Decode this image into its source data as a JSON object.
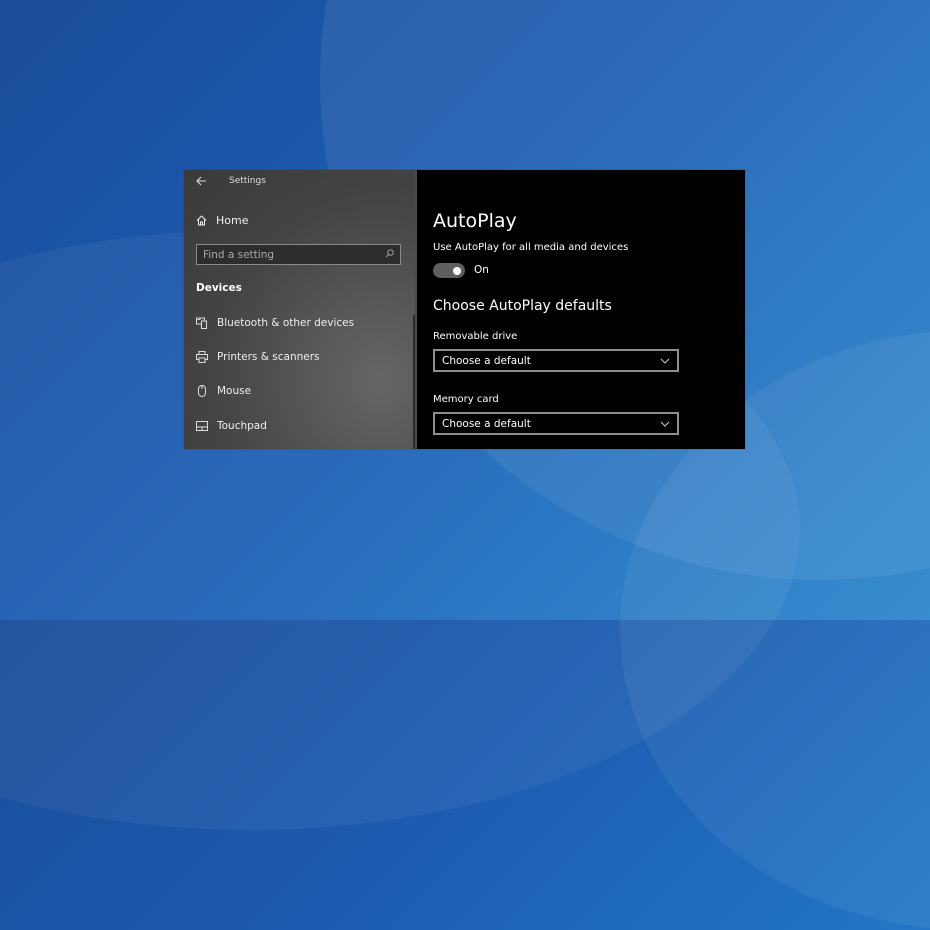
{
  "window": {
    "title": "Settings",
    "back_icon": "back-arrow-icon"
  },
  "sidebar": {
    "home_label": "Home",
    "search_placeholder": "Find a setting",
    "section": "Devices",
    "items": [
      {
        "label": "Bluetooth & other devices",
        "icon": "bluetooth-devices-icon"
      },
      {
        "label": "Printers & scanners",
        "icon": "printer-icon"
      },
      {
        "label": "Mouse",
        "icon": "mouse-icon"
      },
      {
        "label": "Touchpad",
        "icon": "touchpad-icon"
      }
    ]
  },
  "main": {
    "title": "AutoPlay",
    "toggle_label": "Use AutoPlay for all media and devices",
    "toggle_state": "On",
    "toggle_on": true,
    "defaults_heading": "Choose AutoPlay defaults",
    "fields": [
      {
        "label": "Removable drive",
        "value": "Choose a default"
      },
      {
        "label": "Memory card",
        "value": "Choose a default"
      }
    ]
  },
  "colors": {
    "right_pane_bg": "#000000",
    "toggle_track": "#5f5f5f",
    "desktop_accent": "#1c5bb0"
  }
}
